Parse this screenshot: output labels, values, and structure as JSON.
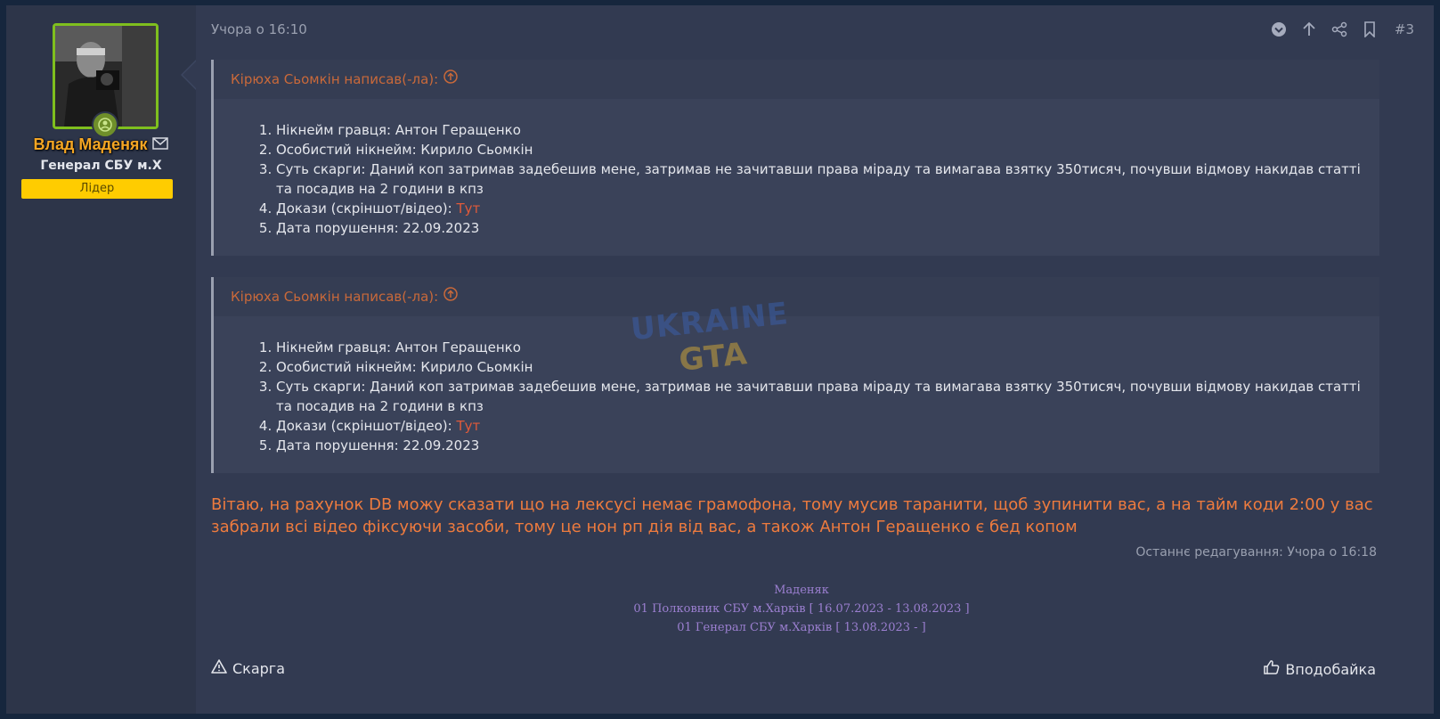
{
  "post": {
    "date": "Учора о 16:10",
    "number": "#3",
    "edited": "Останнє редагування: Учора о 16:18"
  },
  "user": {
    "name": "Влад Маденяк",
    "title": "Генерал СБУ м.Х",
    "banner": "Лідер"
  },
  "quotes": [
    {
      "author": "Кірюха Сьомкін написав(-ла):",
      "items": [
        "Нікнейм гравця: Антон Геращенко",
        "Особистий нікнейм: Кирило Сьомкін",
        "Суть скарги: Даний коп затримав задебешив мене, затримав не зачитавши права міраду та вимагава взятку 350тисяч, почувши відмову накидав статті та посадив на 2 години в кпз",
        "Докази (скріншот/відео): ",
        "Дата порушення: 22.09.2023"
      ],
      "link": "Тут"
    },
    {
      "author": "Кірюха Сьомкін написав(-ла):",
      "items": [
        "Нікнейм гравця: Антон Геращенко",
        "Особистий нікнейм: Кирило Сьомкін",
        "Суть скарги: Даний коп затримав задебешив мене, затримав не зачитавши права міраду та вимагава взятку 350тисяч, почувши відмову накидав статті та посадив на 2 години в кпз",
        "Докази (скріншот/відео): ",
        "Дата порушення: 22.09.2023"
      ],
      "link": "Тут"
    }
  ],
  "reply": "Вітаю, на рахунок DB можу сказати що на лексусі немає грамофона, тому мусив таранити, щоб зупинити вас, а на тайм коди 2:00 у вас забрали всі відео фіксуючи засоби, тому це нон рп дія від вас, а також Антон Геращенко є бед копом",
  "signature": {
    "line1": "Маденяк",
    "line2": "01 Полковник СБУ м.Харків [ 16.07.2023 - 13.08.2023 ]",
    "line3": "01 Генерал СБУ м.Харків [ 13.08.2023 - ]"
  },
  "watermark": {
    "line1": "UKRAINE",
    "line2": "GTA"
  },
  "footer": {
    "report": "Скарга",
    "like": "Вподобайка"
  },
  "colors": {
    "background": "#16263d",
    "post_bg": "#323a51",
    "quote_author": "#c9693a",
    "reply_text": "#ee7b3e",
    "username": "#f5a623",
    "banner": "#ffcc00",
    "signature": "#9b7fd0",
    "avatar_border": "#7fbf1e"
  },
  "icons": [
    "envelope-icon",
    "user-online-icon",
    "chevron-down-circle-icon",
    "arrow-up-icon",
    "share-icon",
    "bookmark-icon",
    "arrow-up-circle-icon",
    "warning-icon",
    "thumbs-up-icon"
  ]
}
